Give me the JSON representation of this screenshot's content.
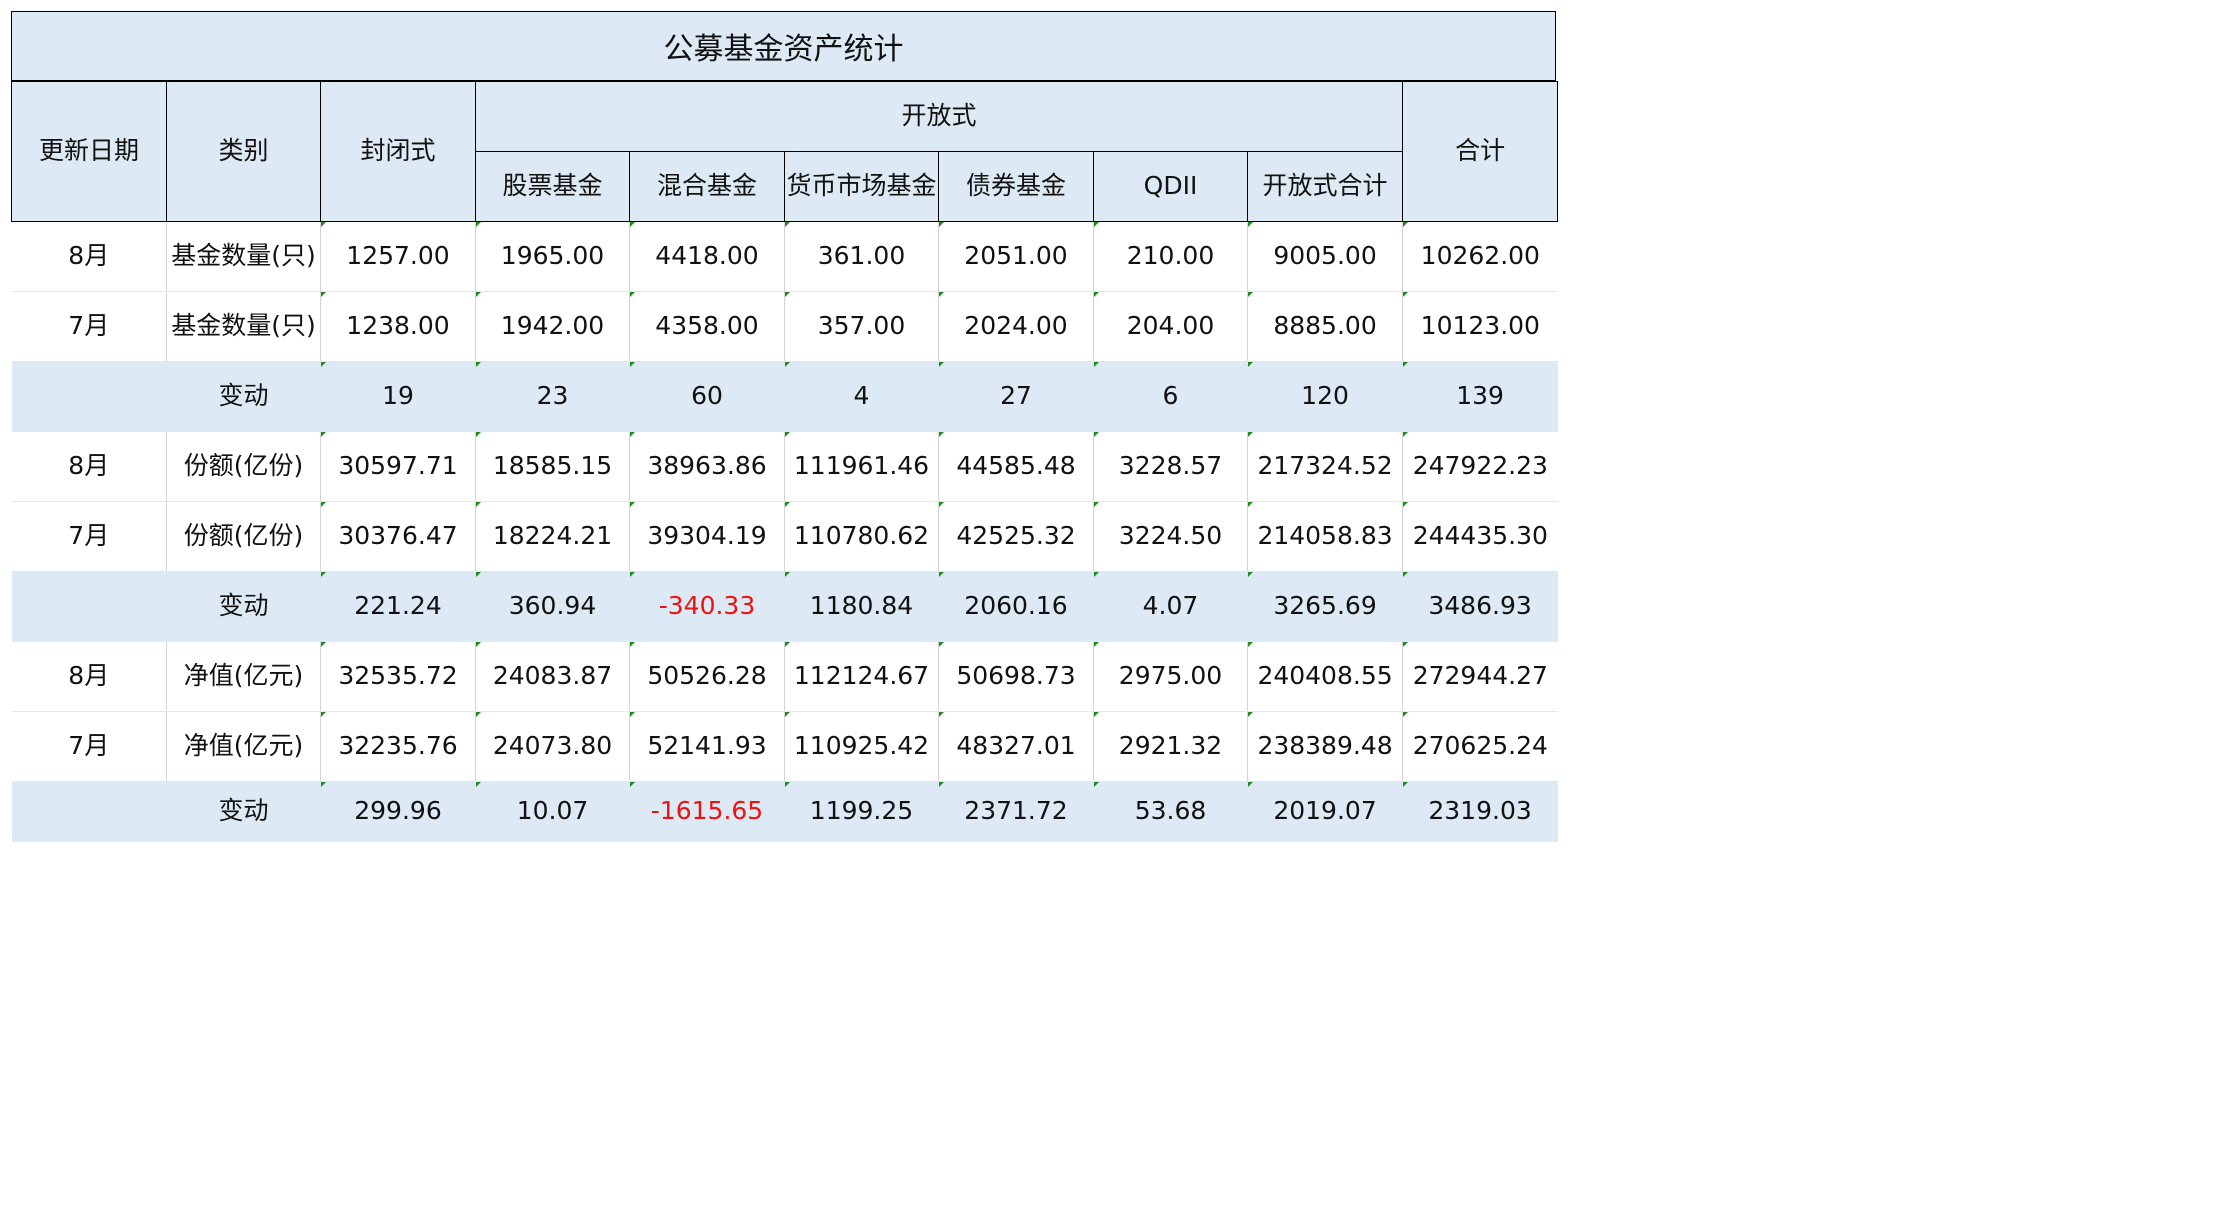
{
  "title": "公募基金资产统计",
  "headers": {
    "date": "更新日期",
    "category": "类别",
    "closed": "封闭式",
    "open_group": "开放式",
    "open_cols": [
      "股票基金",
      "混合基金",
      "货币市场基金",
      "债券基金",
      "QDII",
      "开放式合计"
    ],
    "total": "合计"
  },
  "rows": [
    {
      "date": "8月",
      "cat": "基金数量(只)",
      "vals": [
        "1257.00",
        "1965.00",
        "4418.00",
        "361.00",
        "2051.00",
        "210.00",
        "9005.00",
        "10262.00"
      ]
    },
    {
      "date": "7月",
      "cat": "基金数量(只)",
      "vals": [
        "1238.00",
        "1942.00",
        "4358.00",
        "357.00",
        "2024.00",
        "204.00",
        "8885.00",
        "10123.00"
      ]
    },
    {
      "date": "",
      "cat": "变动",
      "vals": [
        "19",
        "23",
        "60",
        "4",
        "27",
        "6",
        "120",
        "139"
      ]
    },
    {
      "date": "8月",
      "cat": "份额(亿份)",
      "vals": [
        "30597.71",
        "18585.15",
        "38963.86",
        "111961.46",
        "44585.48",
        "3228.57",
        "217324.52",
        "247922.23"
      ]
    },
    {
      "date": "7月",
      "cat": "份额(亿份)",
      "vals": [
        "30376.47",
        "18224.21",
        "39304.19",
        "110780.62",
        "42525.32",
        "3224.50",
        "214058.83",
        "244435.30"
      ]
    },
    {
      "date": "",
      "cat": "变动",
      "vals": [
        "221.24",
        "360.94",
        "-340.33",
        "1180.84",
        "2060.16",
        "4.07",
        "3265.69",
        "3486.93"
      ]
    },
    {
      "date": "8月",
      "cat": "净值(亿元)",
      "vals": [
        "32535.72",
        "24083.87",
        "50526.28",
        "112124.67",
        "50698.73",
        "2975.00",
        "240408.55",
        "272944.27"
      ]
    },
    {
      "date": "7月",
      "cat": "净值(亿元)",
      "vals": [
        "32235.76",
        "24073.80",
        "52141.93",
        "110925.42",
        "48327.01",
        "2921.32",
        "238389.48",
        "270625.24"
      ]
    },
    {
      "date": "",
      "cat": "变动",
      "vals": [
        "299.96",
        "10.07",
        "-1615.65",
        "1199.25",
        "2371.72",
        "53.68",
        "2019.07",
        "2319.03"
      ]
    }
  ],
  "colors": {
    "header_bg": "#dde9f4",
    "negative": "#ee1111",
    "marker": "#1f8a1f"
  }
}
